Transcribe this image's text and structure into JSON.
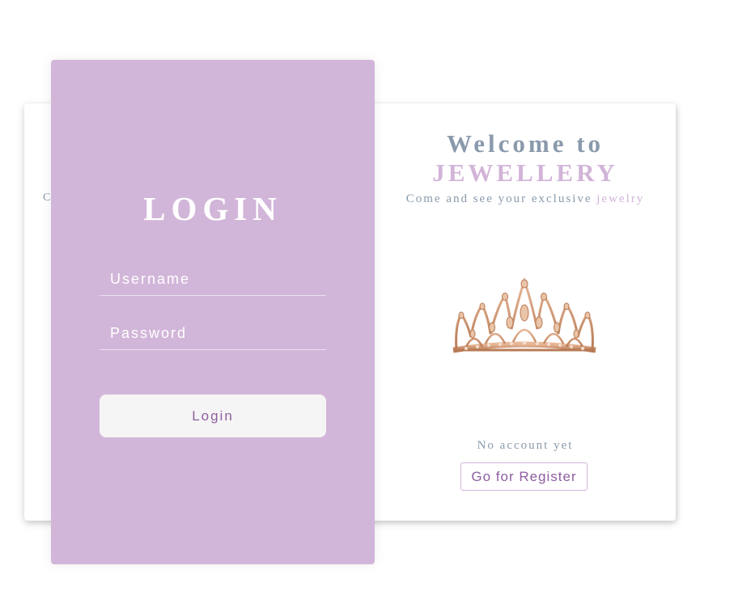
{
  "welcome": {
    "title": "Welcome to",
    "brand": "JEWELLERY",
    "tagline_prefix": "Come and see your exclusive ",
    "tagline_accent": "jewelry",
    "crown_image": "crown-icon",
    "no_account_text": "No account yet",
    "register_button": "Go for Register"
  },
  "hidden_text": "C",
  "login": {
    "heading": "LOGIN",
    "username_placeholder": "Username",
    "password_placeholder": "Password",
    "submit_label": "Login"
  },
  "colors": {
    "panel": "#d2b6d9",
    "accent": "#d2b4d8",
    "muted": "#8a9aac",
    "button_text": "#8e5ea0"
  }
}
